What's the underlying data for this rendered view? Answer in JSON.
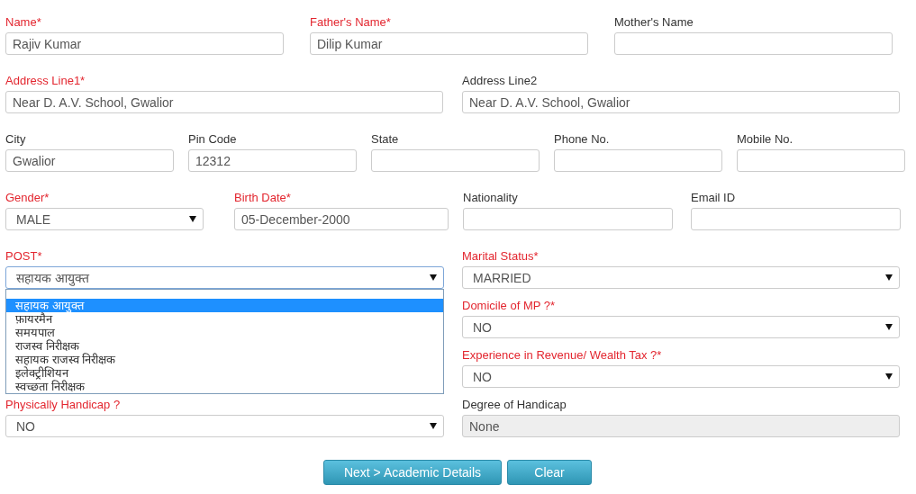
{
  "top_rows": [
    {
      "fields": [
        {
          "label": "Name*",
          "required": true,
          "kind": "text",
          "value": "Rajiv Kumar"
        },
        {
          "label": "Father's Name*",
          "required": true,
          "kind": "text",
          "value": "Dilip Kumar"
        },
        {
          "label": "Mother's Name",
          "required": false,
          "kind": "text"
        }
      ]
    },
    {
      "fields": [
        {
          "label": "Address Line1*",
          "required": true,
          "kind": "text",
          "value": "Near D. A.V. School, Gwalior"
        },
        {
          "label": "Address Line2",
          "required": false,
          "kind": "text",
          "value": "Near D. A.V. School, Gwalior"
        }
      ]
    },
    {
      "fields": [
        {
          "label": "City",
          "required": false,
          "kind": "text",
          "value": "Gwalior"
        },
        {
          "label": "Pin Code",
          "required": false,
          "kind": "text",
          "value": "12312"
        },
        {
          "label": "State",
          "required": false,
          "kind": "text"
        },
        {
          "label": "Phone No.",
          "required": false,
          "kind": "text"
        },
        {
          "label": "Mobile No.",
          "required": false,
          "kind": "text"
        }
      ]
    },
    {
      "fields": [
        {
          "label": "Gender*",
          "required": true,
          "kind": "select",
          "value": "MALE"
        },
        {
          "label": "Birth Date*",
          "required": true,
          "kind": "text",
          "value": "05-December-2000"
        },
        {
          "label": "Nationality",
          "required": false,
          "kind": "text"
        },
        {
          "label": "Email ID",
          "required": false,
          "kind": "text"
        }
      ]
    }
  ],
  "left_column": [
    {
      "label": "POST*",
      "required": true,
      "kind": "select",
      "value": "सहायक आयुक्त",
      "open": true,
      "options": [
        {
          "label": "सहायक आयुक्त",
          "selected": true
        },
        {
          "label": "फ़ायरमैन",
          "selected": false
        },
        {
          "label": "समयपाल",
          "selected": false
        },
        {
          "label": "राजस्व निरीक्षक",
          "selected": false
        },
        {
          "label": "सहायक राजस्व निरीक्षक",
          "selected": false
        },
        {
          "label": "इलेक्ट्रीशियन",
          "selected": false
        },
        {
          "label": "स्वच्छता निरीक्षक",
          "selected": false
        }
      ]
    },
    {
      "label": "Physically Handicap ?",
      "required": true,
      "kind": "select",
      "value": "NO"
    }
  ],
  "right_column": [
    {
      "label": "Marital Status*",
      "required": true,
      "kind": "select",
      "value": "MARRIED"
    },
    {
      "label": "Domicile of MP ?*",
      "required": true,
      "kind": "select",
      "value": "NO"
    },
    {
      "label": "Experience in Revenue/ Wealth Tax ?*",
      "required": true,
      "kind": "select",
      "value": "NO"
    },
    {
      "label": "Degree of Handicap",
      "required": false,
      "kind": "readonly",
      "value": "None"
    }
  ],
  "buttons": [
    "Next > Academic Details",
    "Clear"
  ]
}
